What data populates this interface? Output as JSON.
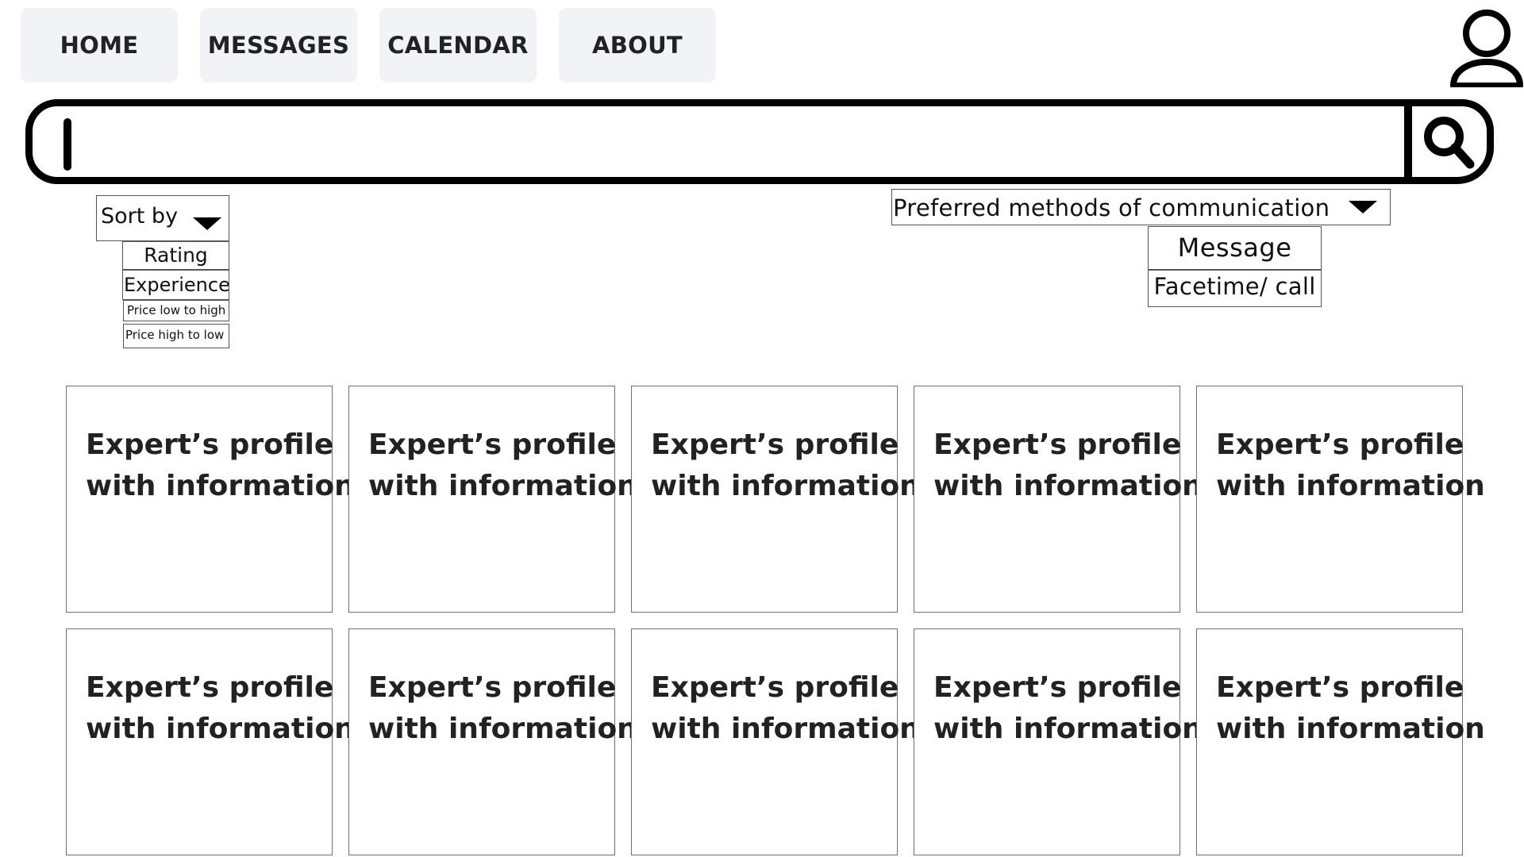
{
  "nav": {
    "home": "HOME",
    "messages": "MESSAGES",
    "calendar": "CALENDAR",
    "about": "ABOUT"
  },
  "header": {
    "avatar_icon": "user-profile-icon"
  },
  "search": {
    "value": "",
    "placeholder": "",
    "button_icon": "search-icon"
  },
  "sort": {
    "label": "Sort by",
    "options": [
      "Rating",
      "Experience",
      "Price low to high",
      "Price high to low"
    ]
  },
  "communication": {
    "label": "Preferred methods of communication",
    "options": [
      "Message",
      "Facetime/ call"
    ]
  },
  "experts": [
    {
      "line1": "Expert’s profile",
      "line2": "with information"
    },
    {
      "line1": "Expert’s profile",
      "line2": "with information"
    },
    {
      "line1": "Expert’s profile",
      "line2": "with information"
    },
    {
      "line1": "Expert’s profile",
      "line2": "with information"
    },
    {
      "line1": "Expert’s profile",
      "line2": "with information"
    },
    {
      "line1": "Expert’s profile",
      "line2": "with information"
    },
    {
      "line1": "Expert’s profile",
      "line2": "with information"
    },
    {
      "line1": "Expert’s profile",
      "line2": "with information"
    },
    {
      "line1": "Expert’s profile",
      "line2": "with information"
    },
    {
      "line1": "Expert’s profile",
      "line2": "with information"
    }
  ],
  "colors": {
    "nav_background": "#f2f3f6",
    "border": "#000000",
    "card_border": "#707070"
  }
}
